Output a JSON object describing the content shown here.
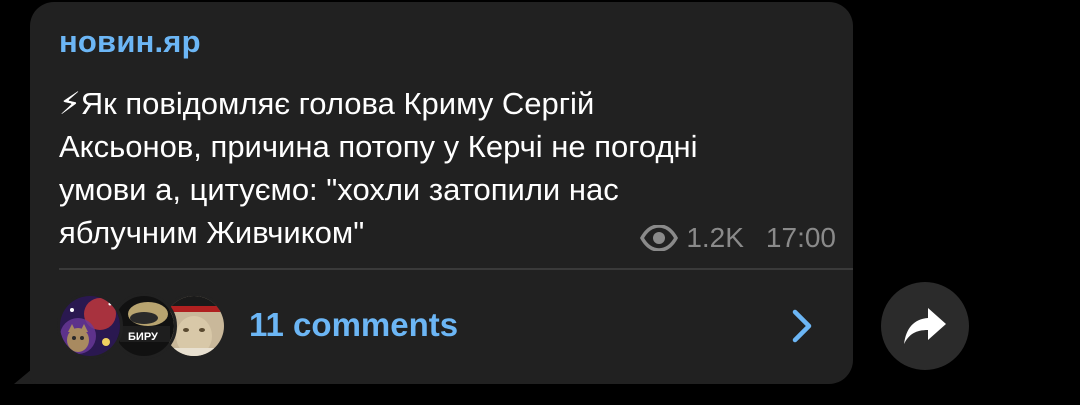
{
  "post": {
    "channel_name": "новин.яр",
    "text": "⚡Як повідомляє голова Криму Сергій\nАксьонов, причина потопу у Керчі не погодні\nумови а, цитуємо: \"хохли затопили нас\nяблучним Живчиком\"",
    "views": "1.2K",
    "time": "17:00",
    "views_icon": "eye-icon"
  },
  "comments": {
    "label": "11 comments",
    "avatar_2_text": "БИРУ",
    "chevron_icon": "chevron-right-icon"
  },
  "share": {
    "icon": "share-arrow-icon"
  },
  "colors": {
    "accent": "#6cb6f5",
    "bubble": "#212121",
    "meta": "#8a8a8a",
    "background": "#000000"
  }
}
